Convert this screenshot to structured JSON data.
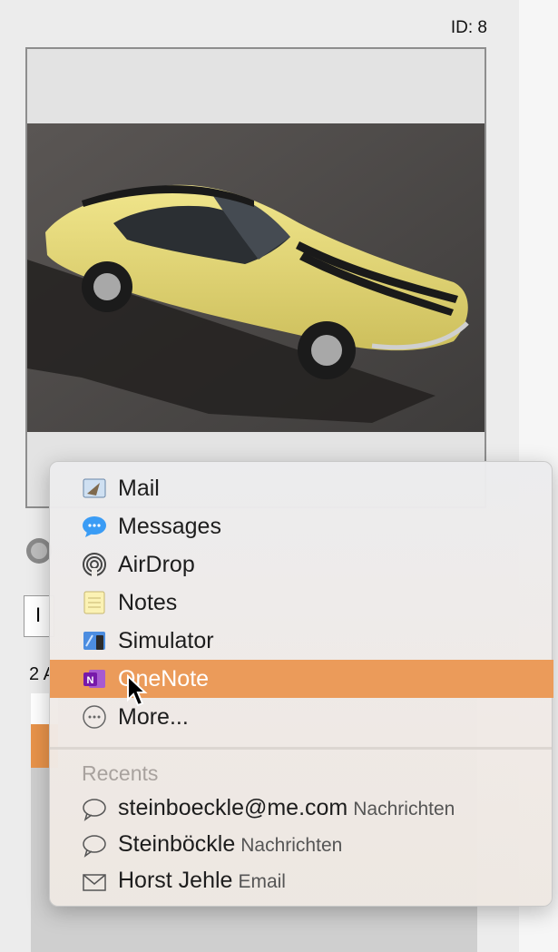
{
  "header": {
    "id_label": "ID: 8"
  },
  "background": {
    "count_text": "2 A"
  },
  "share_menu": {
    "items": [
      {
        "label": "Mail",
        "icon": "mail-icon"
      },
      {
        "label": "Messages",
        "icon": "messages-icon"
      },
      {
        "label": "AirDrop",
        "icon": "airdrop-icon"
      },
      {
        "label": "Notes",
        "icon": "notes-icon"
      },
      {
        "label": "Simulator",
        "icon": "simulator-icon"
      },
      {
        "label": "OneNote",
        "icon": "onenote-icon",
        "highlighted": true
      },
      {
        "label": "More...",
        "icon": "more-icon"
      }
    ],
    "recents_title": "Recents",
    "recents": [
      {
        "name": "steinboeckle@me.com",
        "via": "Nachrichten",
        "icon": "speech-bubble-icon"
      },
      {
        "name": "Steinböckle",
        "via": "Nachrichten",
        "icon": "speech-bubble-icon"
      },
      {
        "name": "Horst Jehle",
        "via": "Email",
        "icon": "envelope-icon"
      }
    ]
  },
  "colors": {
    "highlight": "#eb9b5a",
    "car": "#e8dc7a"
  }
}
